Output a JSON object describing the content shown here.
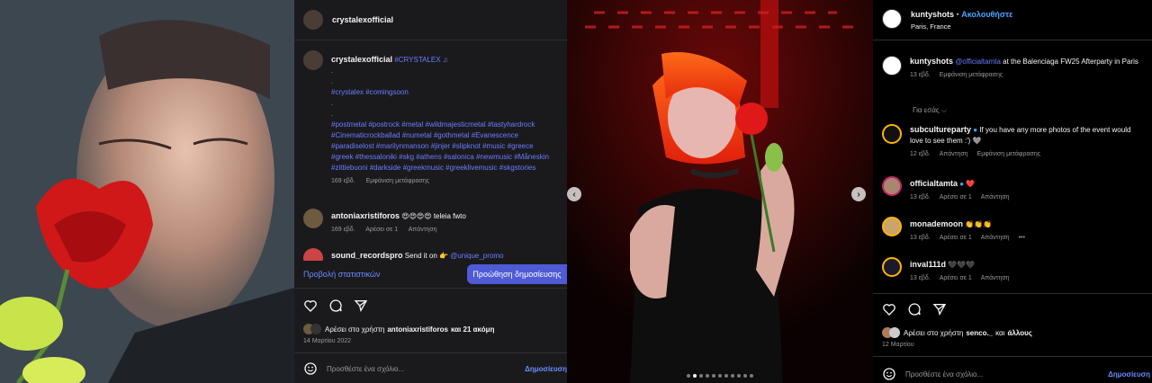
{
  "left_post": {
    "username": "crystalexofficial",
    "caption_user": "crystalexofficial",
    "caption_tag": "#CRYSTALEX",
    "caption_note": "♫",
    "dot_lines": [
      ".",
      ".",
      ".",
      "."
    ],
    "hashtags_line1": "#crystalex #comingsoon",
    "hashtags_block": "#postmetal #postrock #metal #wildmajesticmetal #tastyhardrock #Cinematicrockballad #numetal #gothmetal #Evanescence #paradiselost #marilynmanson #jinjer #slipknot #music #greece #greek #thessaloniki #skg #athens #salonica #newmusic #Måneskin #zittiebuoni #darkside #greekmusic #greeklivemusic #skgstories",
    "caption_meta_time": "169 εβδ.",
    "caption_meta_translate": "Εμφάνιση μετάφρασης",
    "comments": [
      {
        "user": "antoniaxristiforos",
        "text": "😍😍😍😍 teleia fwto",
        "time": "169 εβδ.",
        "likes": "Αρέσει σε 1",
        "reply": "Απάντηση"
      },
      {
        "user": "sound_recordspro",
        "text": "Send it on 👉",
        "tag": "@unique_promo"
      }
    ],
    "stats_link": "Προβολή στατιστικών",
    "promote_button": "Προώθηση δημοσίευσης",
    "liked_by_prefix": "Αρέσει στο χρήστη",
    "liked_by_user": "antoniaxristiforos",
    "liked_by_suffix": "και 21 ακόμη",
    "date": "14 Μαρτίου 2022",
    "comment_placeholder": "Προσθέστε ένα σχόλιο...",
    "post_button": "Δημοσίευση"
  },
  "right_post": {
    "username": "kuntyshots",
    "bullet": "•",
    "follow": "Ακολουθήστε",
    "location": "Paris, France",
    "caption_user": "kuntyshots",
    "caption_mention": "@officialtamta",
    "caption_text": "at the Balenciaga FW25 Afterparty in Paris",
    "caption_meta_time": "13 εβδ.",
    "caption_meta_translate": "Εμφάνιση μετάφρασης",
    "for_you": "Για εσάς",
    "comments": [
      {
        "user": "subcultureparty",
        "text": "If you have any more photos of the event would love to see them :') 🩶",
        "time": "12 εβδ.",
        "likes": "Απάντηση",
        "reply": "Εμφάνιση μετάφρασης"
      },
      {
        "user": "officialtamta",
        "text": "❤️",
        "time": "13 εβδ.",
        "likes": "Αρέσει σε 1",
        "reply": "Απάντηση"
      },
      {
        "user": "monademoon",
        "text": "👏👏👏",
        "time": "13 εβδ.",
        "likes": "Αρέσει σε 1",
        "reply": "Απάντηση",
        "more": "•••"
      },
      {
        "user": "inval111d",
        "text": "🖤🖤🖤",
        "time": "13 εβδ.",
        "likes": "Αρέσει σε 1",
        "reply": "Απάντηση"
      }
    ],
    "liked_by_prefix": "Αρέσει στο χρήστη",
    "liked_by_user": "senco._",
    "liked_by_suffix": "και",
    "liked_by_others": "άλλους",
    "date": "12 Μαρτίου",
    "comment_placeholder": "Προσθέστε ένα σχόλιο...",
    "post_button": "Δημοσίευση"
  },
  "carousel": {
    "prev_icon": "chevron-left-icon",
    "next_icon": "chevron-right-icon",
    "prev_glyph": "‹",
    "next_glyph": "›",
    "dots_count": 11,
    "active_dot": 1
  },
  "colors": {
    "accent": "#4f5bd5",
    "link": "#6c7cff",
    "verified": "#4aa3ff",
    "dark_panel": "#1a1a1d"
  }
}
